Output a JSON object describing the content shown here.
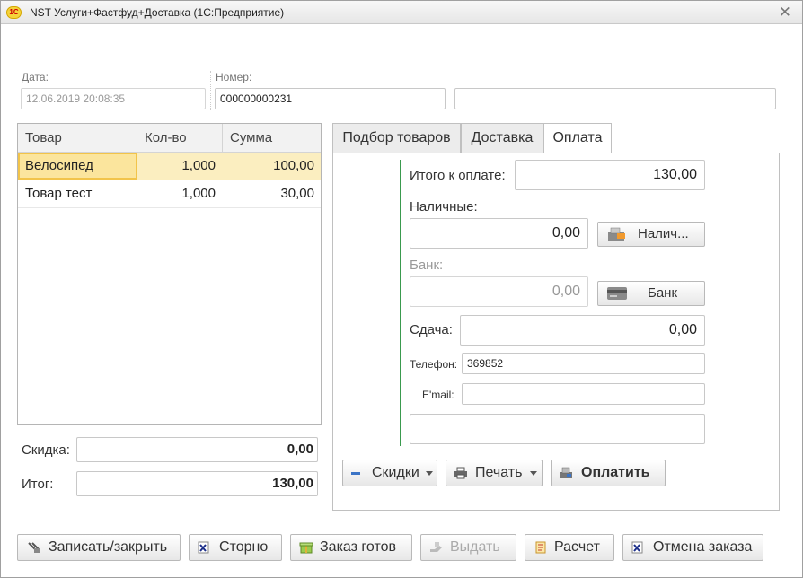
{
  "window": {
    "title": "NST Услуги+Фастфуд+Доставка  (1С:Предприятие)",
    "logo": "1С",
    "close": "✕"
  },
  "header": {
    "date_label": "Дата:",
    "date_value": "12.06.2019 20:08:35",
    "number_label": "Номер:",
    "number_value": "000000000231",
    "extra_value": ""
  },
  "table": {
    "columns": [
      "Товар",
      "Кол-во",
      "Сумма"
    ],
    "rows": [
      {
        "name": "Велосипед",
        "qty": "1,000",
        "sum": "100,00"
      },
      {
        "name": "Товар тест",
        "qty": "1,000",
        "sum": "30,00"
      }
    ]
  },
  "totals": {
    "discount_label": "Скидка:",
    "discount_value": "0,00",
    "total_label": "Итог:",
    "total_value": "130,00"
  },
  "tabs": [
    "Подбор товаров",
    "Доставка",
    "Оплата"
  ],
  "payment": {
    "total_label": "Итого к оплате:",
    "total_value": "130,00",
    "cash_label": "Наличные:",
    "cash_value": "0,00",
    "cash_button": "Налич...",
    "bank_label": "Банк:",
    "bank_value": "0,00",
    "bank_button": "Банк",
    "change_label": "Сдача:",
    "change_value": "0,00",
    "phone_label": "Телефон:",
    "phone_value": "369852",
    "email_label": "E'mail:",
    "email_value": "",
    "note_value": ""
  },
  "payment_buttons": {
    "discounts": "Скидки",
    "print": "Печать",
    "pay": "Оплатить"
  },
  "footer": {
    "save_close": "Записать/закрыть",
    "storno": "Сторно",
    "order_ready": "Заказ готов",
    "issue": "Выдать",
    "calc": "Расчет",
    "cancel_order": "Отмена заказа"
  },
  "colors": {
    "accent_line": "#3a9a4e",
    "selected_row": "#fbeec0",
    "focus_cell": "#f2c44a"
  }
}
